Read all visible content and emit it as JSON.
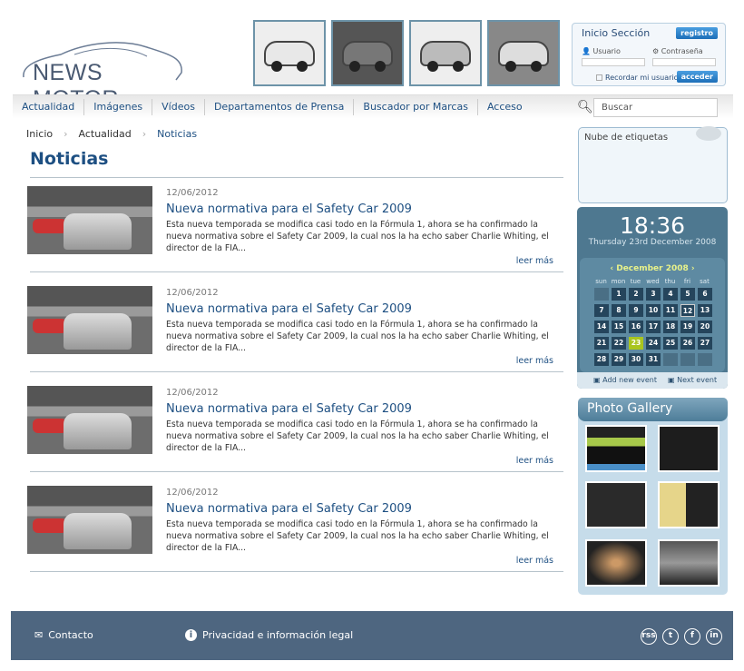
{
  "logo": {
    "text": "NEWS MOTOR"
  },
  "login": {
    "title": "Inicio Sección",
    "register_label": "registro",
    "user_label": "Usuario",
    "password_label": "Contraseña",
    "remember_label": "Recordar mi usuario",
    "submit_label": "acceder"
  },
  "nav": {
    "items": [
      "Actualidad",
      "Imágenes",
      "Vídeos",
      "Departamentos de Prensa",
      "Buscador por Marcas",
      "Acceso"
    ]
  },
  "search": {
    "placeholder": "Buscar"
  },
  "breadcrumb": [
    "Inicio",
    "Actualidad",
    "Noticias"
  ],
  "page_title": "Noticias",
  "news": [
    {
      "date": "12/06/2012",
      "title": "Nueva normativa para el Safety Car 2009",
      "body": "Esta nueva temporada se modifica casi todo en la Fórmula 1, ahora se ha confirmado la nueva normativa sobre el  Safety Car 2009, la cual nos la ha echo saber Charlie Whiting, el director de la FIA...",
      "more": "leer más"
    },
    {
      "date": "12/06/2012",
      "title": "Nueva normativa para el Safety Car 2009",
      "body": "Esta nueva temporada se modifica casi todo en la Fórmula 1, ahora se ha confirmado la nueva normativa sobre el  Safety Car 2009, la cual nos la ha echo saber Charlie Whiting, el director de la FIA...",
      "more": "leer más"
    },
    {
      "date": "12/06/2012",
      "title": "Nueva normativa para el Safety Car 2009",
      "body": "Esta nueva temporada se modifica casi todo en la Fórmula 1, ahora se ha confirmado la nueva normativa sobre el  Safety Car 2009, la cual nos la ha echo saber Charlie Whiting, el director de la FIA...",
      "more": "leer más"
    },
    {
      "date": "12/06/2012",
      "title": "Nueva normativa para el Safety Car 2009",
      "body": "Esta nueva temporada se modifica casi todo en la Fórmula 1, ahora se ha confirmado la nueva normativa sobre el  Safety Car 2009, la cual nos la ha echo saber Charlie Whiting, el director de la FIA...",
      "more": "leer más"
    }
  ],
  "tag_cloud": {
    "title": "Nube de etiquetas"
  },
  "calendar": {
    "time": "18:36",
    "date": "Thursday 23rd December 2008",
    "month": "‹  December 2008  ›",
    "weekdays": [
      "sun",
      "mon",
      "tue",
      "wed",
      "thu",
      "fri",
      "sat"
    ],
    "days": [
      "",
      "1",
      "2",
      "3",
      "4",
      "5",
      "6",
      "7",
      "8",
      "9",
      "10",
      "11",
      "12",
      "13",
      "14",
      "15",
      "16",
      "17",
      "18",
      "19",
      "20",
      "21",
      "22",
      "23",
      "24",
      "25",
      "26",
      "27",
      "28",
      "29",
      "30",
      "31",
      "",
      "",
      ""
    ],
    "selected_day": "23",
    "hover_day": "12",
    "add_event": "Add new event",
    "next_event": "Next event"
  },
  "gallery": {
    "title": "Photo Gallery"
  },
  "footer": {
    "contact": "Contacto",
    "privacy": "Privacidad e información legal",
    "social": [
      "rss",
      "t",
      "f",
      "in"
    ]
  }
}
